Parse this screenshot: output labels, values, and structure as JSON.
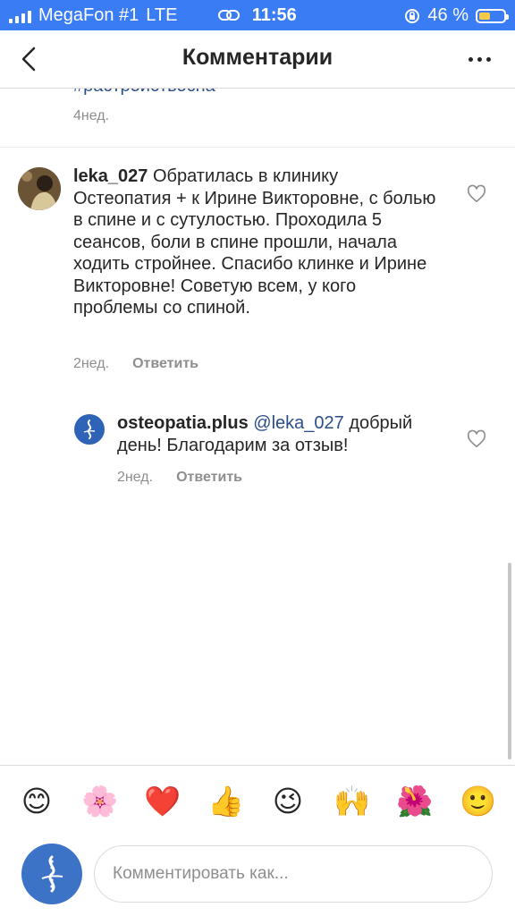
{
  "status": {
    "carrier": "MegaFon #1",
    "network": "LTE",
    "time": "11:56",
    "battery_text": "46 %",
    "battery_level": 0.46,
    "battery_color": "#f7c948",
    "bar_color": "#3a7cf4"
  },
  "nav": {
    "title": "Комментарии",
    "back_icon": "chevron-left-icon",
    "more_icon": "more-horizontal-icon"
  },
  "prev_comment": {
    "hashtag": "#растройствосна",
    "time": "4нед."
  },
  "comments": [
    {
      "username": "leka_027",
      "text": "Обратилась в клинику Остеопатия + к Ирине Викторовне, с болью в спине и с сутулостью. Проходила 5 сеансов, боли в спине прошли, начала ходить стройнее. Спасибо клинке и Ирине Викторовне! Советую всем, у кого проблемы со спиной.",
      "time": "2нед.",
      "reply_label": "Ответить"
    }
  ],
  "reply": {
    "username": "osteopatia.plus",
    "mention": "@leka_027",
    "text": "добрый день! Благодарим за отзыв!",
    "time": "2нед.",
    "reply_label": "Ответить"
  },
  "emojis": [
    "😊",
    "🌸",
    "❤️",
    "👍",
    "😉",
    "🙌",
    "🌺",
    "🙂"
  ],
  "composer": {
    "placeholder": "Комментировать как..."
  },
  "colors": {
    "accent": "#3a7cf4",
    "link": "#2b4e8a",
    "meta": "#8e8e8e"
  }
}
